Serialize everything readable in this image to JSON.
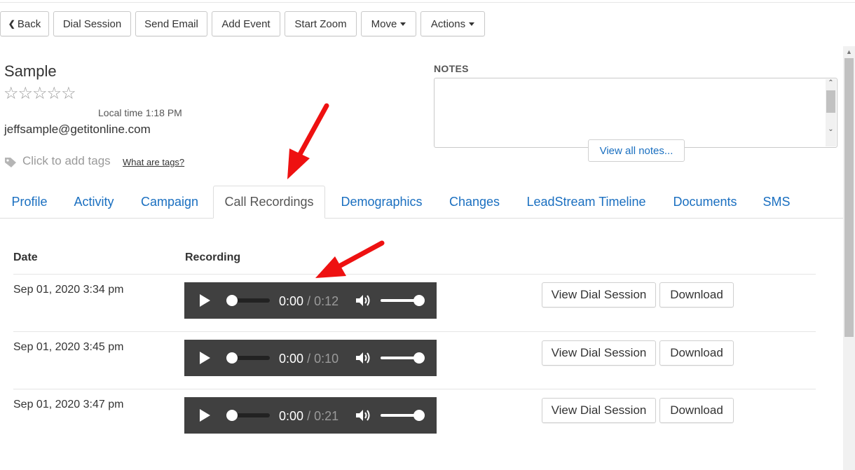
{
  "toolbar": {
    "back_label": "Back",
    "dial_session_label": "Dial Session",
    "send_email_label": "Send Email",
    "add_event_label": "Add Event",
    "start_zoom_label": "Start Zoom",
    "move_label": "Move",
    "actions_label": "Actions"
  },
  "contact": {
    "name": "Sample",
    "rating": 0,
    "rating_max": 5,
    "local_time": "Local time 1:18 PM",
    "email": "jeffsample@getitonline.com",
    "tags_placeholder": "Click to add tags",
    "tags_help_link": "What are tags?"
  },
  "notes": {
    "label": "NOTES",
    "value": "",
    "view_all_label": "View all notes..."
  },
  "tabs": [
    {
      "label": "Profile",
      "active": false
    },
    {
      "label": "Activity",
      "active": false
    },
    {
      "label": "Campaign",
      "active": false
    },
    {
      "label": "Call Recordings",
      "active": true
    },
    {
      "label": "Demographics",
      "active": false
    },
    {
      "label": "Changes",
      "active": false
    },
    {
      "label": "LeadStream Timeline",
      "active": false
    },
    {
      "label": "Documents",
      "active": false
    },
    {
      "label": "SMS",
      "active": false
    }
  ],
  "recordings_table": {
    "headers": {
      "date": "Date",
      "recording": "Recording"
    },
    "rows": [
      {
        "date": "Sep 01, 2020 3:34 pm",
        "current_time": "0:00",
        "duration": "/ 0:12",
        "view_label": "View Dial Session",
        "download_label": "Download"
      },
      {
        "date": "Sep 01, 2020 3:45 pm",
        "current_time": "0:00",
        "duration": "/ 0:10",
        "view_label": "View Dial Session",
        "download_label": "Download"
      },
      {
        "date": "Sep 01, 2020 3:47 pm",
        "current_time": "0:00",
        "duration": "/ 0:21",
        "view_label": "View Dial Session",
        "download_label": "Download"
      }
    ]
  },
  "colors": {
    "link_blue": "#1a6fc0",
    "player_bg": "#404040",
    "annotation_arrow": "#ee1111"
  },
  "icons": {
    "back": "chevron-left-icon",
    "tag": "tag-icon",
    "play": "play-icon",
    "volume": "speaker-icon",
    "star": "star-outline-icon"
  }
}
